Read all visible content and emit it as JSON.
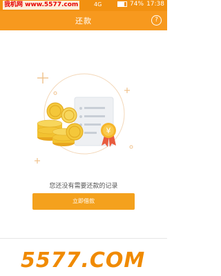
{
  "status_bar": {
    "watermark": "我机网 www.5577.com",
    "network": "4G",
    "battery": "74%",
    "time": "17:38"
  },
  "header": {
    "title": "还款",
    "help_symbol": "?"
  },
  "empty_state": {
    "message": "您还没有需要还款的记录",
    "badge_symbol": "¥"
  },
  "cta": {
    "label": "立即借款"
  },
  "watermark_bottom": "5577.COM",
  "colors": {
    "accent": "#f7991e",
    "button": "#f4a11d",
    "coin": "#f2c230"
  }
}
